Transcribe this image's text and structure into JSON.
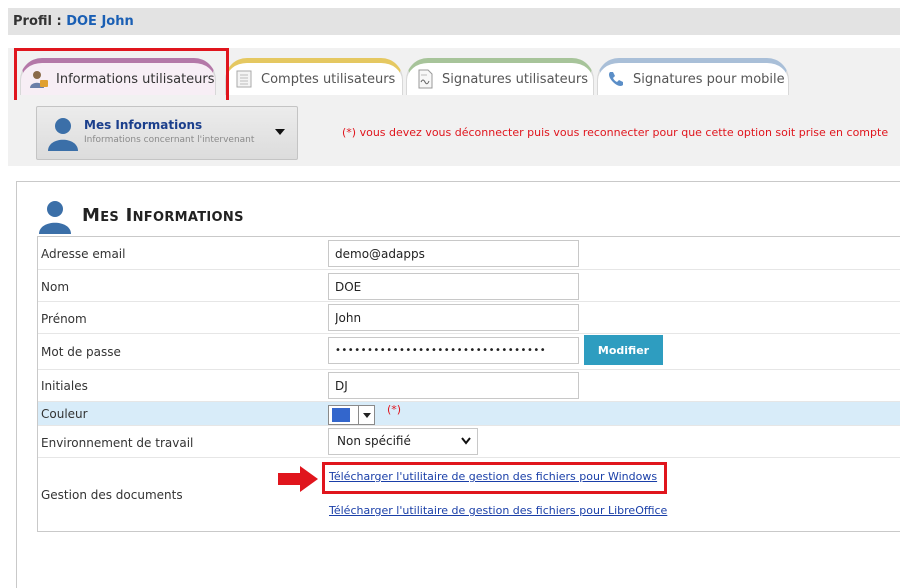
{
  "header": {
    "label": "Profil :",
    "user": "DOE John"
  },
  "tabs": [
    {
      "label": "Informations utilisateurs",
      "icon": "user-info-icon"
    },
    {
      "label": "Comptes utilisateurs",
      "icon": "notebook-icon"
    },
    {
      "label": "Signatures utilisateurs",
      "icon": "signature-document-icon"
    },
    {
      "label": "Signatures pour mobile",
      "icon": "phone-icon"
    }
  ],
  "section_select": {
    "title": "Mes Informations",
    "subtitle": "Informations concernant l'intervenant"
  },
  "notice": "(*) vous devez vous déconnecter puis vous reconnecter pour que cette option soit prise en compte",
  "panel": {
    "title": "Mes Informations"
  },
  "form": {
    "email": {
      "label": "Adresse email",
      "value": "demo@adapps"
    },
    "nom": {
      "label": "Nom",
      "value": "DOE"
    },
    "prenom": {
      "label": "Prénom",
      "value": "John"
    },
    "password": {
      "label": "Mot de passe",
      "value": "•••••••••••••••••••••••••••••••••",
      "button": "Modifier"
    },
    "initiales": {
      "label": "Initiales",
      "value": "DJ"
    },
    "couleur": {
      "label": "Couleur",
      "color": "#3366cc",
      "required_mark": "(*)"
    },
    "environnement": {
      "label": "Environnement de travail",
      "value": "Non spécifié"
    },
    "documents": {
      "label": "Gestion des documents",
      "link_windows": "Télécharger l'utilitaire de gestion des fichiers pour Windows",
      "link_libreoffice": "Télécharger l'utilitaire de gestion des fichiers pour LibreOffice"
    }
  },
  "colors": {
    "accent": "#2e9dc0",
    "highlight": "#e0151d",
    "link": "#1a3fa8",
    "title_user": "#1a5fb4"
  }
}
